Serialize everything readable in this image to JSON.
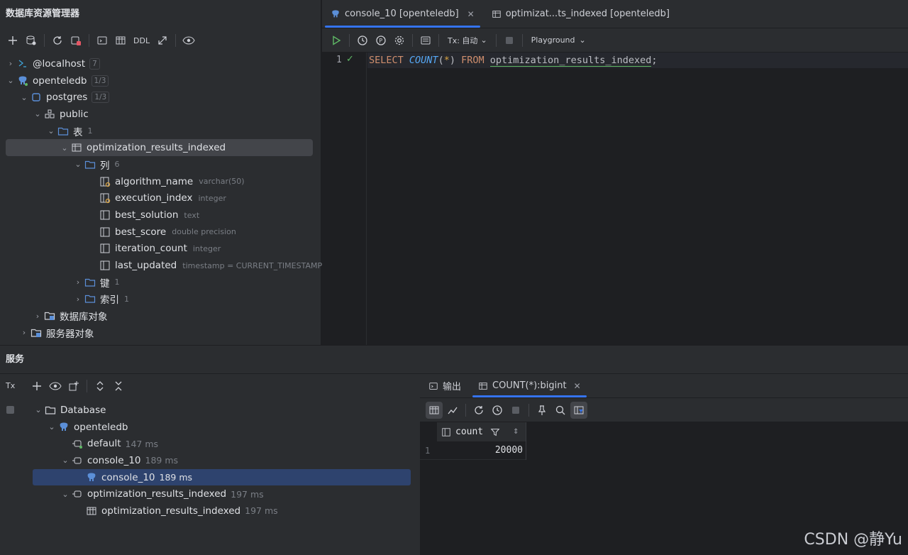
{
  "explorer": {
    "title": "数据库资源管理器",
    "toolbar": {
      "ddl_label": "DDL"
    },
    "tree": {
      "localhost": {
        "label": "@localhost",
        "count": "7"
      },
      "openteledb": {
        "label": "openteledb",
        "badge": "1/3"
      },
      "postgres": {
        "label": "postgres",
        "badge": "1/3"
      },
      "public": {
        "label": "public"
      },
      "tables": {
        "label": "表",
        "count": "1"
      },
      "table": {
        "label": "optimization_results_indexed"
      },
      "columns_folder": {
        "label": "列",
        "count": "6"
      },
      "columns": [
        {
          "name": "algorithm_name",
          "type": "varchar(50)"
        },
        {
          "name": "execution_index",
          "type": "integer"
        },
        {
          "name": "best_solution",
          "type": "text"
        },
        {
          "name": "best_score",
          "type": "double precision"
        },
        {
          "name": "iteration_count",
          "type": "integer"
        },
        {
          "name": "last_updated",
          "type": "timestamp = CURRENT_TIMESTAMP"
        }
      ],
      "keys": {
        "label": "键",
        "count": "1"
      },
      "indexes": {
        "label": "索引",
        "count": "1"
      },
      "db_objects": {
        "label": "数据库对象"
      },
      "server_objects": {
        "label": "服务器对象"
      }
    }
  },
  "editor": {
    "tabs": [
      {
        "label": "console_10 [openteledb]"
      },
      {
        "label": "optimizat...ts_indexed [openteledb]"
      }
    ],
    "toolbar": {
      "tx_label": "Tx: 自动",
      "playground_label": "Playground"
    },
    "line_number": "1",
    "sql": {
      "select": "SELECT",
      "count_fn": "COUNT",
      "open": "(",
      "star": "*",
      "close": ")",
      "from": "FROM",
      "table": "optimization_results_indexed",
      "semi": ";"
    }
  },
  "services": {
    "title": "服务",
    "tx_label": "Tx",
    "tree": {
      "database": {
        "label": "Database"
      },
      "openteledb": {
        "label": "openteledb"
      },
      "default": {
        "label": "default",
        "ms": "147 ms"
      },
      "console_group": {
        "label": "console_10",
        "ms": "189 ms"
      },
      "console_item": {
        "label": "console_10",
        "ms": "189 ms"
      },
      "opt_group": {
        "label": "optimization_results_indexed",
        "ms": "197 ms"
      },
      "opt_item": {
        "label": "optimization_results_indexed",
        "ms": "197 ms"
      }
    },
    "result_tabs": [
      {
        "label": "输出"
      },
      {
        "label": "COUNT(*):bigint"
      }
    ],
    "grid": {
      "column": "count",
      "rows": [
        {
          "n": "1",
          "value": "20000"
        }
      ]
    }
  },
  "watermark": "CSDN @静Yu",
  "colors": {
    "accent": "#3574f0",
    "selection": "#2e436e",
    "keyword": "#cf8e6d",
    "function": "#56a8f5",
    "success": "#5fb865"
  }
}
